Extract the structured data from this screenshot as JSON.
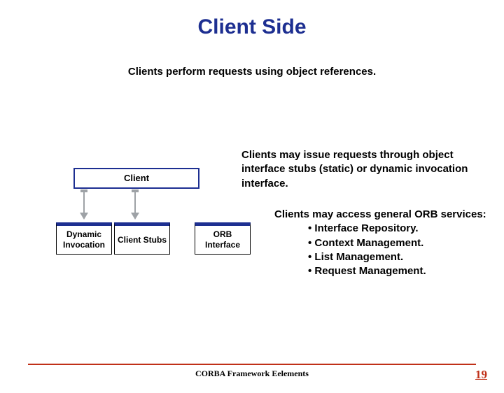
{
  "title": "Client Side",
  "subtitle": "Clients perform requests using object references.",
  "client_label": "Client",
  "note_stubs": "Clients may issue requests through object interface stubs (static) or dynamic invocation interface.",
  "boxes": {
    "dynamic": "Dynamic Invocation",
    "stubs": "Client Stubs",
    "orb": "ORB Interface"
  },
  "services": {
    "intro": "Clients may access general ORB services:",
    "items": [
      "Interface Repository.",
      "Context Management.",
      "List Management.",
      "Request Management."
    ]
  },
  "footer": "CORBA Framework Eelements",
  "page": "19"
}
